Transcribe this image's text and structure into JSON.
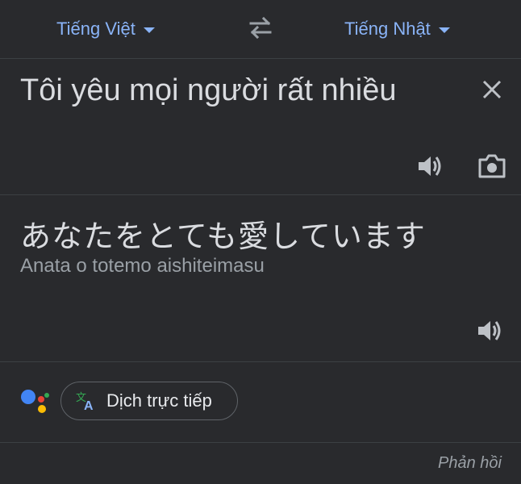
{
  "header": {
    "source_language": "Tiếng Việt",
    "target_language": "Tiếng Nhật",
    "swap_icon": "swap-arrows-icon",
    "dropdown_icon": "caret-down-icon"
  },
  "source": {
    "text": "Tôi yêu mọi người rất nhiều",
    "icons": [
      "close-icon",
      "speaker-icon",
      "camera-icon"
    ]
  },
  "translation": {
    "text": "あなたをとても愛しています",
    "transliteration": "Anata o totemo aishiteimasu",
    "icons": [
      "speaker-icon"
    ]
  },
  "actions": {
    "assistant_icon": "google-assistant-icon",
    "live_translate_label": "Dịch trực tiếp",
    "live_translate_icon": "translate-icon"
  },
  "footer": {
    "feedback_label": "Phản hồi"
  },
  "colors": {
    "background": "#292a2d",
    "accent": "#8ab4f8",
    "divider": "#3c4043",
    "text": "#dadce0",
    "muted": "#9aa0a6"
  }
}
